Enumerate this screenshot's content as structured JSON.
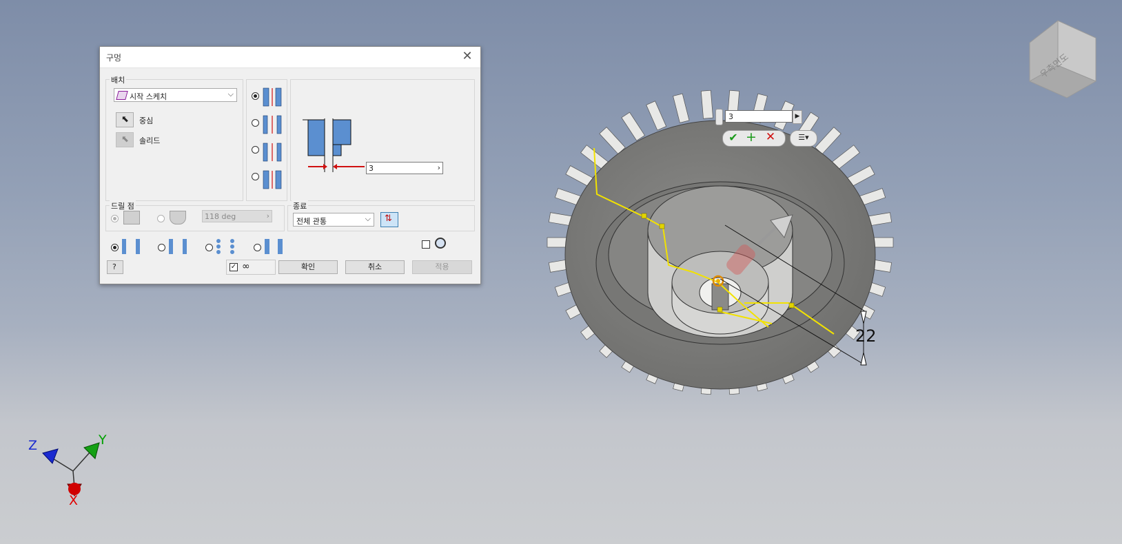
{
  "dialog": {
    "title": "구멍",
    "placement_group": "배치",
    "placement_combo": "시작 스케치",
    "center_label": "중심",
    "solid_label": "솔리드",
    "diameter_value": "3",
    "drill_point_group": "드릴 점",
    "drill_angle": "118 deg",
    "termination_group": "종료",
    "termination_value": "전체 관통",
    "ok": "확인",
    "cancel": "취소",
    "apply": "적용"
  },
  "viewport": {
    "mini_value": "3",
    "dimension_value": "22",
    "viewcube_label": "우측면도",
    "axes": {
      "x": "X",
      "y": "Y",
      "z": "Z"
    }
  },
  "colors": {
    "accent_yellow": "#f2e200",
    "axis_x": "#e00000",
    "axis_y": "#00a000",
    "axis_z": "#1a2ad0"
  }
}
